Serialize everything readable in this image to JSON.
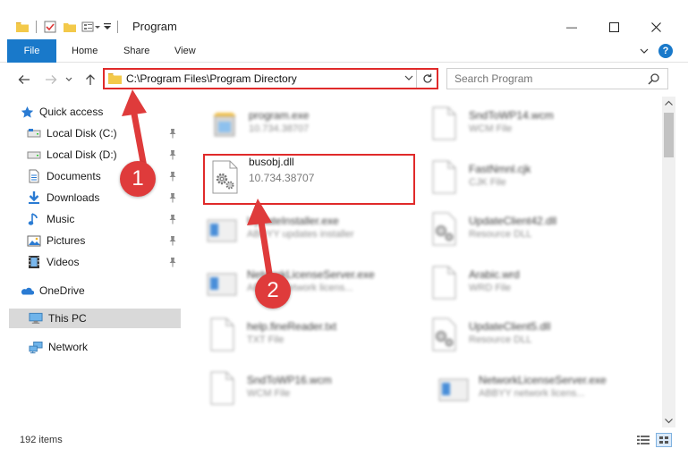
{
  "window": {
    "title": "Program",
    "minimize_glyph": "—",
    "maximize_glyph": "☐",
    "close_glyph": "✕",
    "help_glyph": "?",
    "expand_glyph": "⌄"
  },
  "ribbon": {
    "tabs": [
      {
        "label": "File"
      },
      {
        "label": "Home"
      },
      {
        "label": "Share"
      },
      {
        "label": "View"
      }
    ]
  },
  "address": {
    "path": "C:\\Program Files\\Program Directory"
  },
  "search": {
    "placeholder": "Search Program"
  },
  "nav": {
    "items": [
      {
        "label": "Quick access",
        "icon": "star-icon"
      },
      {
        "label": "Local Disk (C:)",
        "icon": "drive-icon",
        "pinned": true
      },
      {
        "label": "Local Disk (D:)",
        "icon": "drive-icon",
        "pinned": true
      },
      {
        "label": "Documents",
        "icon": "documents-icon",
        "pinned": true
      },
      {
        "label": "Downloads",
        "icon": "downloads-icon",
        "pinned": true
      },
      {
        "label": "Music",
        "icon": "music-icon",
        "pinned": true
      },
      {
        "label": "Pictures",
        "icon": "pictures-icon",
        "pinned": true
      },
      {
        "label": "Videos",
        "icon": "videos-icon",
        "pinned": true
      },
      {
        "label": "OneDrive",
        "icon": "onedrive-icon"
      },
      {
        "label": "This PC",
        "icon": "this-pc-icon",
        "selected": true
      },
      {
        "label": "Network",
        "icon": "network-icon"
      }
    ]
  },
  "files": [
    {
      "name": "program.exe",
      "desc": "10.734.38707",
      "icon": "exe-icon"
    },
    {
      "name": "SndToWP14.wcm",
      "desc": "WCM File",
      "icon": "blank-file-icon"
    },
    {
      "name": "busobj.dll",
      "desc": "10.734.38707",
      "icon": "dll-gear-icon",
      "highlighted": true
    },
    {
      "name": "FastNmnl.cjk",
      "desc": "CJK File",
      "icon": "blank-file-icon"
    },
    {
      "name": "UpdateInstaller.exe",
      "desc": "ABBYY updates installer",
      "icon": "app-window-icon"
    },
    {
      "name": "UpdateClient42.dll",
      "desc": "Resource DLL",
      "icon": "dll-gear-icon"
    },
    {
      "name": "NetworkLicenseServer.exe",
      "desc": "ABBYY network licens...",
      "icon": "app-window-icon"
    },
    {
      "name": "Arabic.wrd",
      "desc": "WRD File",
      "icon": "blank-file-icon"
    },
    {
      "name": "help.fineReader.txt",
      "desc": "TXT File",
      "icon": "blank-file-icon"
    },
    {
      "name": "UpdateClient5.dll",
      "desc": "Resource DLL",
      "icon": "dll-gear-icon"
    },
    {
      "name": "SndToWP16.wcm",
      "desc": "WCM File",
      "icon": "blank-file-icon"
    },
    {
      "name": "NetworkLicenseServer.exe",
      "desc": "ABBYY network licens...",
      "icon": "app-window-icon"
    }
  ],
  "status": {
    "count": "192 items"
  },
  "annotations": {
    "step1": "1",
    "step2": "2"
  },
  "colors": {
    "accent": "#1979ca",
    "highlight_red": "#e02a2a",
    "badge_red": "#df3b3b",
    "selected_bg": "#d9d9d9"
  }
}
